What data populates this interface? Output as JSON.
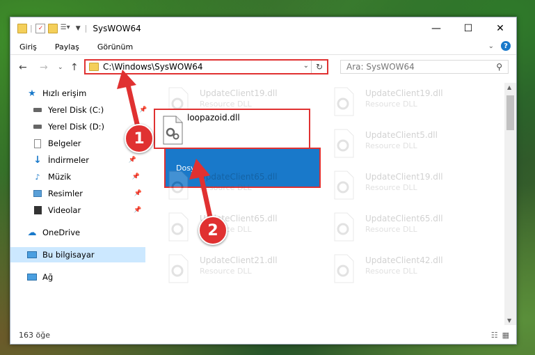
{
  "window": {
    "title": "SysWOW64"
  },
  "controls": {
    "minimize": "—",
    "maximize": "☐",
    "close": "✕"
  },
  "ribbon": {
    "tabs": [
      "Dosya",
      "Giriş",
      "Paylaş",
      "Görünüm"
    ]
  },
  "address": {
    "path": "C:\\Windows\\SysWOW64"
  },
  "search": {
    "placeholder": "Ara: SysWOW64"
  },
  "sidebar": {
    "items": [
      {
        "label": "Hızlı erişim"
      },
      {
        "label": "Yerel Disk (C:)"
      },
      {
        "label": "Yerel Disk (D:)"
      },
      {
        "label": "Belgeler"
      },
      {
        "label": "İndirmeler"
      },
      {
        "label": "Müzik"
      },
      {
        "label": "Resimler"
      },
      {
        "label": "Videolar"
      },
      {
        "label": "OneDrive"
      },
      {
        "label": "Bu bilgisayar"
      },
      {
        "label": "Ağ"
      }
    ]
  },
  "files": {
    "selected": {
      "name": "loopazoid.dll"
    },
    "ghosts": [
      {
        "name": "UpdateClient19.dll",
        "type": "Resource DLL"
      },
      {
        "name": "UpdateClient19.dll",
        "type": "Resource DLL"
      },
      {
        "name": "UpdateClient5.dll",
        "type": "Resource DLL"
      },
      {
        "name": "UpdateClient65.dll",
        "type": "Resource DLL"
      },
      {
        "name": "UpdateClient19.dll",
        "type": "Resource DLL"
      },
      {
        "name": "UpdateClient65.dll",
        "type": "Resource DLL"
      },
      {
        "name": "UpdateClient65.dll",
        "type": "Resource DLL"
      },
      {
        "name": "UpdateClient21.dll",
        "type": "Resource DLL"
      },
      {
        "name": "UpdateClient42.dll",
        "type": "Resource DLL"
      }
    ]
  },
  "status": {
    "count": "163 öğe"
  },
  "annotations": {
    "step1": "1",
    "step2": "2"
  },
  "colors": {
    "accent": "#1979ca",
    "highlight": "#e03131"
  }
}
